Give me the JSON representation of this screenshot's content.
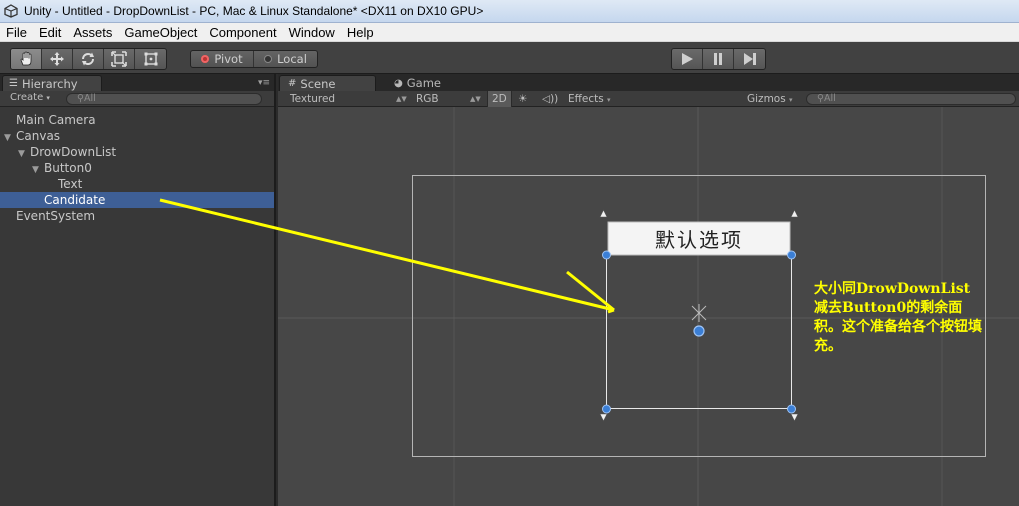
{
  "window": {
    "title": "Unity - Untitled - DropDownList - PC, Mac & Linux Standalone* <DX11 on DX10 GPU>"
  },
  "menu": [
    "File",
    "Edit",
    "Assets",
    "GameObject",
    "Component",
    "Window",
    "Help"
  ],
  "toolbar": {
    "transform_tools": [
      "hand-icon",
      "move-icon",
      "rotate-icon",
      "scale-icon",
      "rect-tool-icon"
    ],
    "pivot_label": "Pivot",
    "local_label": "Local",
    "play_controls": [
      "play-icon",
      "pause-icon",
      "step-icon"
    ]
  },
  "hierarchy": {
    "tab_label": "Hierarchy",
    "create_label": "Create",
    "search_placeholder": "All",
    "items": [
      {
        "label": "Main Camera",
        "depth": 0,
        "expanded": null,
        "selected": false
      },
      {
        "label": "Canvas",
        "depth": 0,
        "expanded": true,
        "selected": false
      },
      {
        "label": "DrowDownList",
        "depth": 1,
        "expanded": true,
        "selected": false
      },
      {
        "label": "Button0",
        "depth": 2,
        "expanded": true,
        "selected": false
      },
      {
        "label": "Text",
        "depth": 3,
        "expanded": null,
        "selected": false
      },
      {
        "label": "Candidate",
        "depth": 2,
        "expanded": null,
        "selected": true
      },
      {
        "label": "EventSystem",
        "depth": 0,
        "expanded": null,
        "selected": false
      }
    ]
  },
  "scene": {
    "scene_tab_label": "Scene",
    "game_tab_label": "Game",
    "shading_mode": "Textured",
    "render_mode": "RGB",
    "mode_2d_label": "2D",
    "effects_label": "Effects",
    "gizmos_label": "Gizmos",
    "search_placeholder": "All",
    "button0_text": "默认选项"
  },
  "annotation": {
    "text": "大小同DrowDownList减去Button0的剩余面积。这个准备给各个按钮填充。",
    "color": "#ffff00"
  },
  "colors": {
    "selection": "#3e5f96",
    "annotation_arrow": "#ffff00",
    "handle": "#3b7fd6"
  }
}
